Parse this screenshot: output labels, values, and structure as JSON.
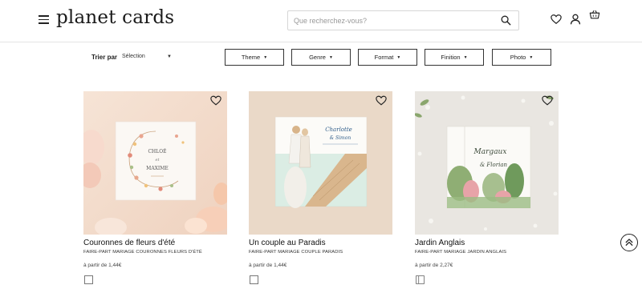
{
  "header": {
    "logo": "planet cards",
    "menu_icon": "hamburger-menu-icon",
    "search_placeholder": "Que recherchez-vous?",
    "search_icon": "search-icon",
    "wishlist_icon": "heart-icon",
    "account_icon": "user-icon",
    "cart_icon": "basket-icon"
  },
  "sort": {
    "label": "Trier par",
    "value": "Sélection"
  },
  "filters": [
    "Theme",
    "Genre",
    "Format",
    "Finition",
    "Photo"
  ],
  "products": [
    {
      "name": "Couronnes de fleurs d'été",
      "subtitle": "FAIRE-PART MARIAGE COURONNES FLEURS D'ÉTÉ",
      "price": "à partir de 1,44€",
      "card_text": [
        "CHLOÉ",
        "et",
        "MAXIME"
      ]
    },
    {
      "name": "Un couple au Paradis",
      "subtitle": "FAIRE-PART MARIAGE COUPLE PARADIS",
      "price": "à partir de 1,44€",
      "card_text": [
        "Charlotte",
        "& Simon"
      ]
    },
    {
      "name": "Jardin Anglais",
      "subtitle": "FAIRE-PART MARIAGE JARDIN ANGLAIS",
      "price": "à partir de 2,27€",
      "card_text": [
        "Margaux",
        "& Florian"
      ]
    }
  ],
  "colors": {
    "text": "#222222",
    "border": "#333333",
    "thumb1_bg": "#f3dccd",
    "thumb2_bg": "#ead9c8",
    "thumb3_bg": "#e8e5e0"
  }
}
